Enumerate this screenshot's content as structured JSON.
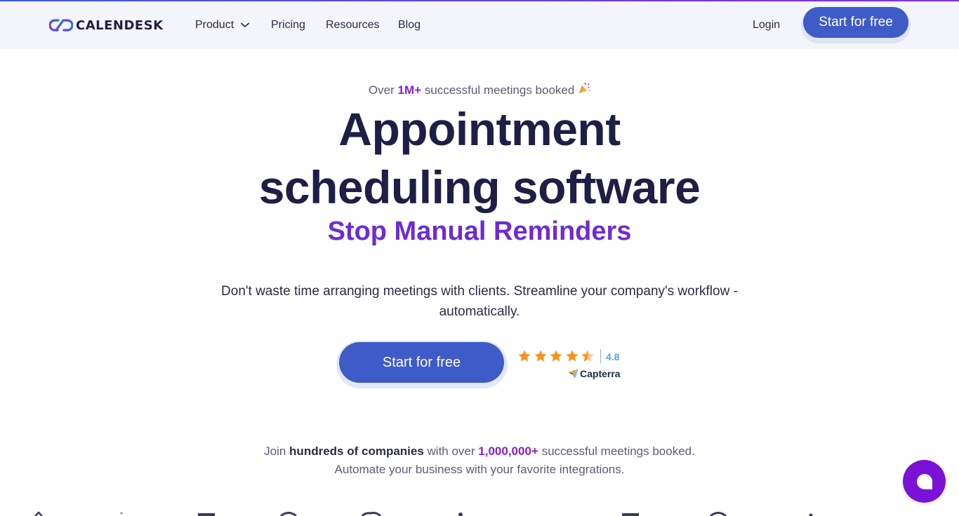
{
  "header": {
    "logo_text": "CALENDESK",
    "nav": [
      {
        "label": "Product",
        "has_dropdown": true
      },
      {
        "label": "Pricing"
      },
      {
        "label": "Resources"
      },
      {
        "label": "Blog"
      }
    ],
    "login_label": "Login",
    "cta_label": "Start for free"
  },
  "hero": {
    "eyebrow_prefix": "Over ",
    "eyebrow_highlight": "1M+",
    "eyebrow_suffix": " successful meetings booked",
    "eyebrow_emoji_icon": "party-popper-icon",
    "title_line1": "Appointment",
    "title_line2": "scheduling software",
    "subtitle": "Stop Manual Reminders",
    "lead": "Don't waste time arranging meetings with clients. Streamline your company's workflow - automatically.",
    "cta_label": "Start for free",
    "rating": {
      "score": "4.8",
      "stars": 5,
      "provider": "Capterra"
    }
  },
  "social_proof": {
    "part1": "Join ",
    "bold1": "hundreds of companies",
    "part2": " with over ",
    "bold2": "1,000,000+",
    "part3": " successful meetings booked.",
    "line2": "Automate your business with your favorite integrations."
  },
  "chat": {
    "icon": "chat-bubble-icon"
  },
  "colors": {
    "brand_blue": "#3e5bc7",
    "accent_purple": "#6f2bd3",
    "highlight_purple": "#8a1fc9",
    "heading_navy": "#1e1f45",
    "star_orange": "#f7931e",
    "chat_purple": "#7a11d6"
  }
}
